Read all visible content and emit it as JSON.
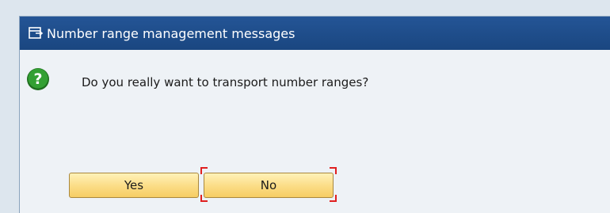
{
  "dialog": {
    "title": "Number range management messages",
    "message": "Do you really want to transport number ranges?",
    "icons": {
      "title": "dialog-window-icon",
      "message": "question-icon"
    },
    "buttons": {
      "yes_label": "Yes",
      "no_label": "No",
      "focused": "No"
    }
  },
  "colors": {
    "titlebar": "#1d4e8c",
    "body": "#eef2f6",
    "button": "#fbdc85",
    "focus": "#e02020",
    "question_icon": "#2e8b2e"
  }
}
